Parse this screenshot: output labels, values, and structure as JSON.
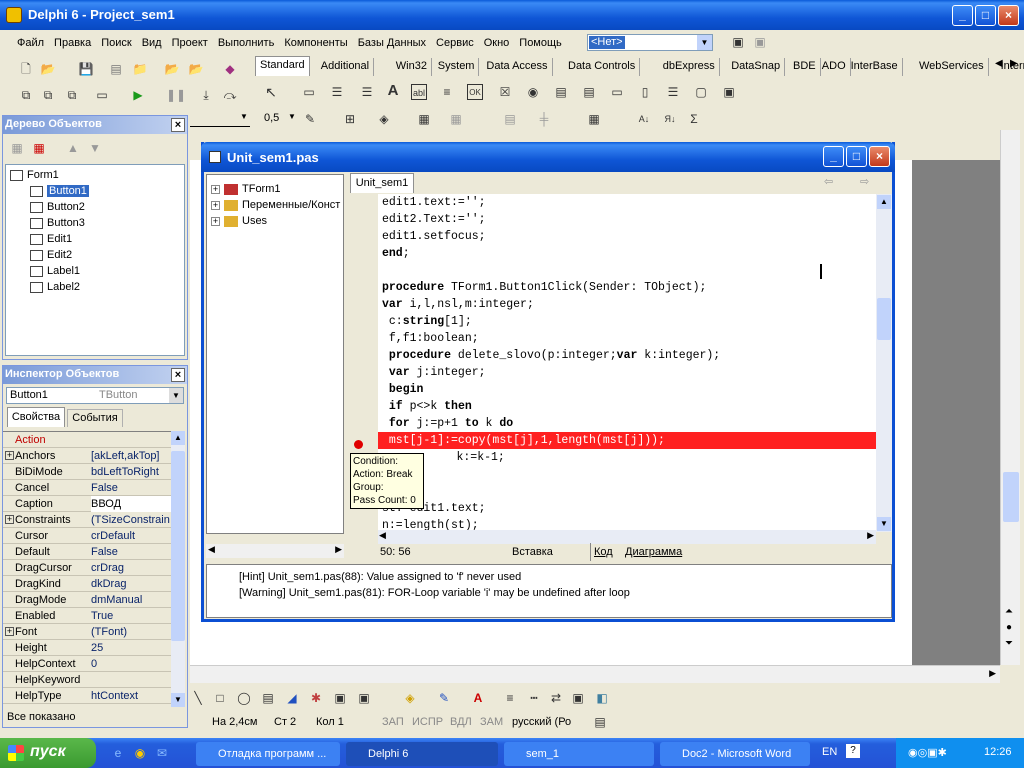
{
  "app": {
    "title": "Delphi 6 - Project_sem1",
    "icon": "delphi-icon"
  },
  "menu": [
    "Файл",
    "Правка",
    "Поиск",
    "Вид",
    "Проект",
    "Выполнить",
    "Компоненты",
    "Базы Данных",
    "Сервис",
    "Окно",
    "Помощь"
  ],
  "desktop_combo": "<Нет>",
  "palette_tabs": [
    "Standard",
    "Additional",
    "Win32",
    "System",
    "Data Access",
    "Data Controls",
    "dbExpress",
    "DataSnap",
    "BDE",
    "ADO",
    "InterBase",
    "WebServices",
    "Internet"
  ],
  "object_tree": {
    "title": "Дерево Объектов",
    "root": "Form1",
    "items": [
      "Button1",
      "Button2",
      "Button3",
      "Edit1",
      "Edit2",
      "Label1",
      "Label2"
    ]
  },
  "inspector": {
    "title": "Инспектор Объектов",
    "selected_object": "Button1",
    "selected_type": "TButton",
    "tab_props": "Свойства",
    "tab_events": "События",
    "rows": [
      {
        "name": "Action",
        "value": ""
      },
      {
        "name": "Anchors",
        "value": "[akLeft,akTop]",
        "expand": "+"
      },
      {
        "name": "BiDiMode",
        "value": "bdLeftToRight"
      },
      {
        "name": "Cancel",
        "value": "False"
      },
      {
        "name": "Caption",
        "value": "ВВОД"
      },
      {
        "name": "Constraints",
        "value": "(TSizeConstrain",
        "expand": "+"
      },
      {
        "name": "Cursor",
        "value": "crDefault"
      },
      {
        "name": "Default",
        "value": "False"
      },
      {
        "name": "DragCursor",
        "value": "crDrag"
      },
      {
        "name": "DragKind",
        "value": "dkDrag"
      },
      {
        "name": "DragMode",
        "value": "dmManual"
      },
      {
        "name": "Enabled",
        "value": "True"
      },
      {
        "name": "Font",
        "value": "(TFont)",
        "expand": "+"
      },
      {
        "name": "Height",
        "value": "25"
      },
      {
        "name": "HelpContext",
        "value": "0"
      },
      {
        "name": "HelpKeyword",
        "value": ""
      },
      {
        "name": "HelpType",
        "value": "htContext"
      }
    ],
    "status": "Все показано"
  },
  "format_bar": {
    "line_width": "0,5"
  },
  "editor": {
    "title": "Unit_sem1.pas",
    "tab": "Unit_sem1",
    "explorer": [
      "TForm1",
      "Переменные/Конст",
      "Uses"
    ],
    "code_lines": [
      "edit1.text:='';",
      "edit2.Text:='';",
      "edit1.setfocus;",
      "end;",
      "",
      "procedure TForm1.Button1Click(Sender: TObject);",
      "var i,l,nsl,m:integer;",
      " c:string[1];",
      " f,f1:boolean;",
      " procedure delete_slovo(p:integer;var k:integer);",
      " var j:integer;",
      " begin",
      " if p<>k then",
      " for j:=p+1 to k do",
      " mst[j-1]:=copy(mst[j],1,length(mst[j]));",
      "     k:=k-1;",
      "",
      "",
      "st:=edit1.text;",
      "n:=length(st);"
    ],
    "breakpoint_line": 14,
    "tooltip": [
      "Condition:",
      "Action: Break",
      "Group:",
      "Pass Count: 0"
    ],
    "status_pos": "50:  56",
    "status_mode": "Вставка",
    "status_tab_code": "Код",
    "status_tab_diagram": "Диаграмма",
    "messages": [
      "[Hint] Unit_sem1.pas(88): Value assigned to 'f' never used",
      "[Warning] Unit_sem1.pas(81): FOR-Loop variable 'i' may be undefined after loop"
    ],
    "breakpoint_color": "#ff2020"
  },
  "word_status": {
    "pos": "На 2,4см",
    "line": "Ст 2",
    "col": "Кол 1",
    "zap": "ЗАП",
    "ispr": "ИСПР",
    "vdl": "ВДЛ",
    "zam": "ЗАМ",
    "lang": "русский (Ро"
  },
  "taskbar": {
    "start": "пуск",
    "buttons": [
      "Отладка программ ...",
      "Delphi 6",
      "sem_1",
      "Doc2 - Microsoft Word"
    ],
    "lang": "EN",
    "clock": "12:26"
  }
}
